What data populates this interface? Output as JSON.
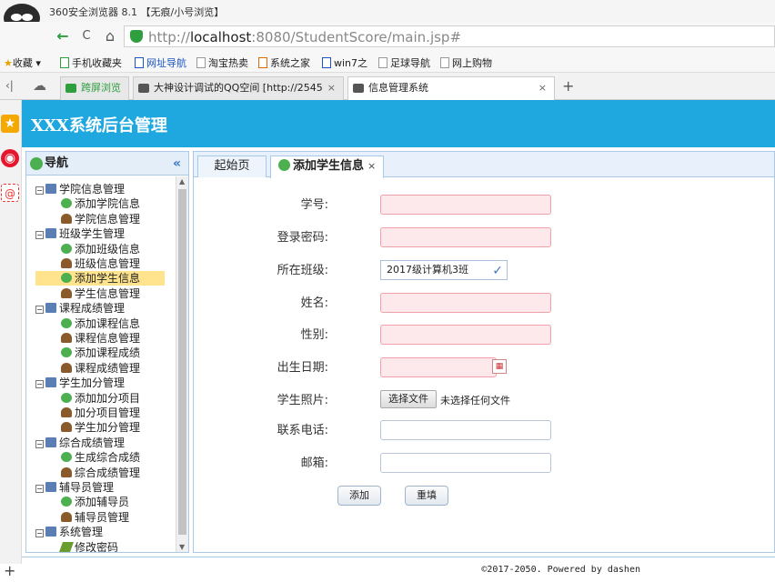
{
  "browser": {
    "window_title": "360安全浏览器 8.1 【无痕/小号浏览】",
    "url_prefix": "http://",
    "url_host": "localhost",
    "url_rest": ":8080/StudentScore/main.jsp#",
    "nav": {
      "back": "←",
      "reload": "C",
      "home": "⌂"
    },
    "bookmarks": [
      {
        "label": "收藏"
      },
      {
        "label": "手机收藏夹"
      },
      {
        "label": "网址导航"
      },
      {
        "label": "淘宝热卖"
      },
      {
        "label": "系统之家"
      },
      {
        "label": "win7之"
      },
      {
        "label": "足球导航"
      },
      {
        "label": "网上购物"
      }
    ],
    "tabs": [
      {
        "label": "跨屏浏览"
      },
      {
        "label": "大神设计调试的QQ空间 [http://2545",
        "close": "×"
      },
      {
        "label": "信息管理系统",
        "close": "×"
      }
    ],
    "new_tab": "+"
  },
  "app": {
    "title": "XXX系统后台管理",
    "nav_title": "导航",
    "collapse_icon": "«",
    "tree": [
      {
        "label": "学院信息管理",
        "type": "folder",
        "toggle": "−"
      },
      {
        "label": "添加学院信息",
        "type": "add"
      },
      {
        "label": "学院信息管理",
        "type": "user"
      },
      {
        "label": "班级学生管理",
        "type": "folder",
        "toggle": "−"
      },
      {
        "label": "添加班级信息",
        "type": "add"
      },
      {
        "label": "班级信息管理",
        "type": "user"
      },
      {
        "label": "添加学生信息",
        "type": "add",
        "selected": true
      },
      {
        "label": "学生信息管理",
        "type": "user"
      },
      {
        "label": "课程成绩管理",
        "type": "folder",
        "toggle": "−"
      },
      {
        "label": "添加课程信息",
        "type": "add"
      },
      {
        "label": "课程信息管理",
        "type": "user"
      },
      {
        "label": "添加课程成绩",
        "type": "add"
      },
      {
        "label": "课程成绩管理",
        "type": "user"
      },
      {
        "label": "学生加分管理",
        "type": "folder",
        "toggle": "−"
      },
      {
        "label": "添加加分项目",
        "type": "add"
      },
      {
        "label": "加分项目管理",
        "type": "user"
      },
      {
        "label": "学生加分管理",
        "type": "user"
      },
      {
        "label": "综合成绩管理",
        "type": "folder",
        "toggle": "−"
      },
      {
        "label": "生成综合成绩",
        "type": "add"
      },
      {
        "label": "综合成绩管理",
        "type": "user"
      },
      {
        "label": "辅导员管理",
        "type": "folder",
        "toggle": "−"
      },
      {
        "label": "添加辅导员",
        "type": "add"
      },
      {
        "label": "辅导员管理",
        "type": "user"
      },
      {
        "label": "系统管理",
        "type": "folder",
        "toggle": "−"
      },
      {
        "label": "修改密码",
        "type": "edit"
      }
    ],
    "tabs": [
      {
        "label": "起始页"
      },
      {
        "label": "添加学生信息",
        "close": "×"
      }
    ],
    "form": {
      "student_no_label": "学号:",
      "password_label": "登录密码:",
      "class_label": "所在班级:",
      "class_value": "2017级计算机3班",
      "class_check": "✓",
      "name_label": "姓名:",
      "gender_label": "性别:",
      "birthday_label": "出生日期:",
      "photo_label": "学生照片:",
      "file_button": "选择文件",
      "file_status": "未选择任何文件",
      "phone_label": "联系电话:",
      "email_label": "邮箱:",
      "submit": "添加",
      "reset": "重填"
    },
    "footer": "©2017-2050. Powered by dashen"
  }
}
